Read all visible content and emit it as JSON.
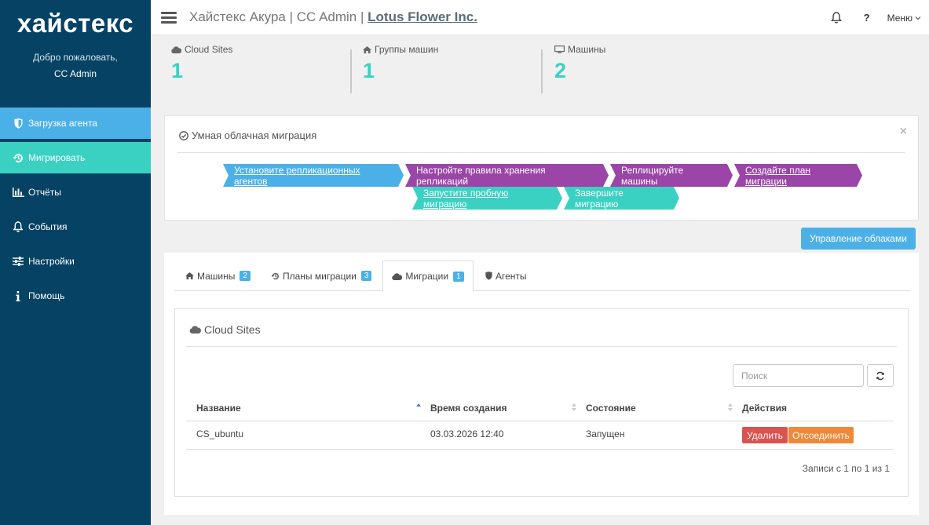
{
  "sidebar": {
    "logo": "хайстекс",
    "welcome": "Добро пожаловать,",
    "user": "CC Admin",
    "items": [
      {
        "label": "Загрузка агента"
      },
      {
        "label": "Мигрировать"
      },
      {
        "label": "Отчёты"
      },
      {
        "label": "События"
      },
      {
        "label": "Настройки"
      },
      {
        "label": "Помощь"
      }
    ]
  },
  "header": {
    "title": "Хайстекс Акура | CC Admin | ",
    "company": "Lotus Flower Inc.",
    "help": "?",
    "menu": "Меню"
  },
  "stats": [
    {
      "label": "Cloud Sites",
      "value": "1"
    },
    {
      "label": "Группы машин",
      "value": "1"
    },
    {
      "label": "Машины",
      "value": "2"
    }
  ],
  "wizard": {
    "title": "Умная облачная миграция",
    "close": "×",
    "steps": [
      "Установите репликационных агентов",
      "Настройте правила хранения репликаций",
      "Реплицируйте машины",
      "Создайте план миграции",
      "Запустите пробную миграцию",
      "Завершите миграцию"
    ]
  },
  "manage_button": "Управление облаками",
  "tabs": [
    {
      "label": "Машины",
      "count": "2"
    },
    {
      "label": "Планы миграции",
      "count": "3"
    },
    {
      "label": "Миграции",
      "count": "1"
    },
    {
      "label": "Агенты"
    }
  ],
  "cloud_sites": {
    "title": "Cloud Sites",
    "search_placeholder": "Поиск",
    "columns": [
      "Название",
      "Время создания",
      "Состояние",
      "Действия"
    ],
    "rows": [
      {
        "name": "CS_ubuntu",
        "created": "03.03.2026 12:40",
        "state": "Запущен",
        "delete": "Удалить",
        "disconnect": "Отсоединить"
      }
    ],
    "footer": "Записи с 1 по 1 из 1"
  },
  "colors": {
    "sidebar": "#064264",
    "accent_blue": "#4cb0e8",
    "accent_teal": "#3ad1c2",
    "purple": "#9b45a8",
    "danger": "#d9534f",
    "warning": "#f0883a"
  }
}
